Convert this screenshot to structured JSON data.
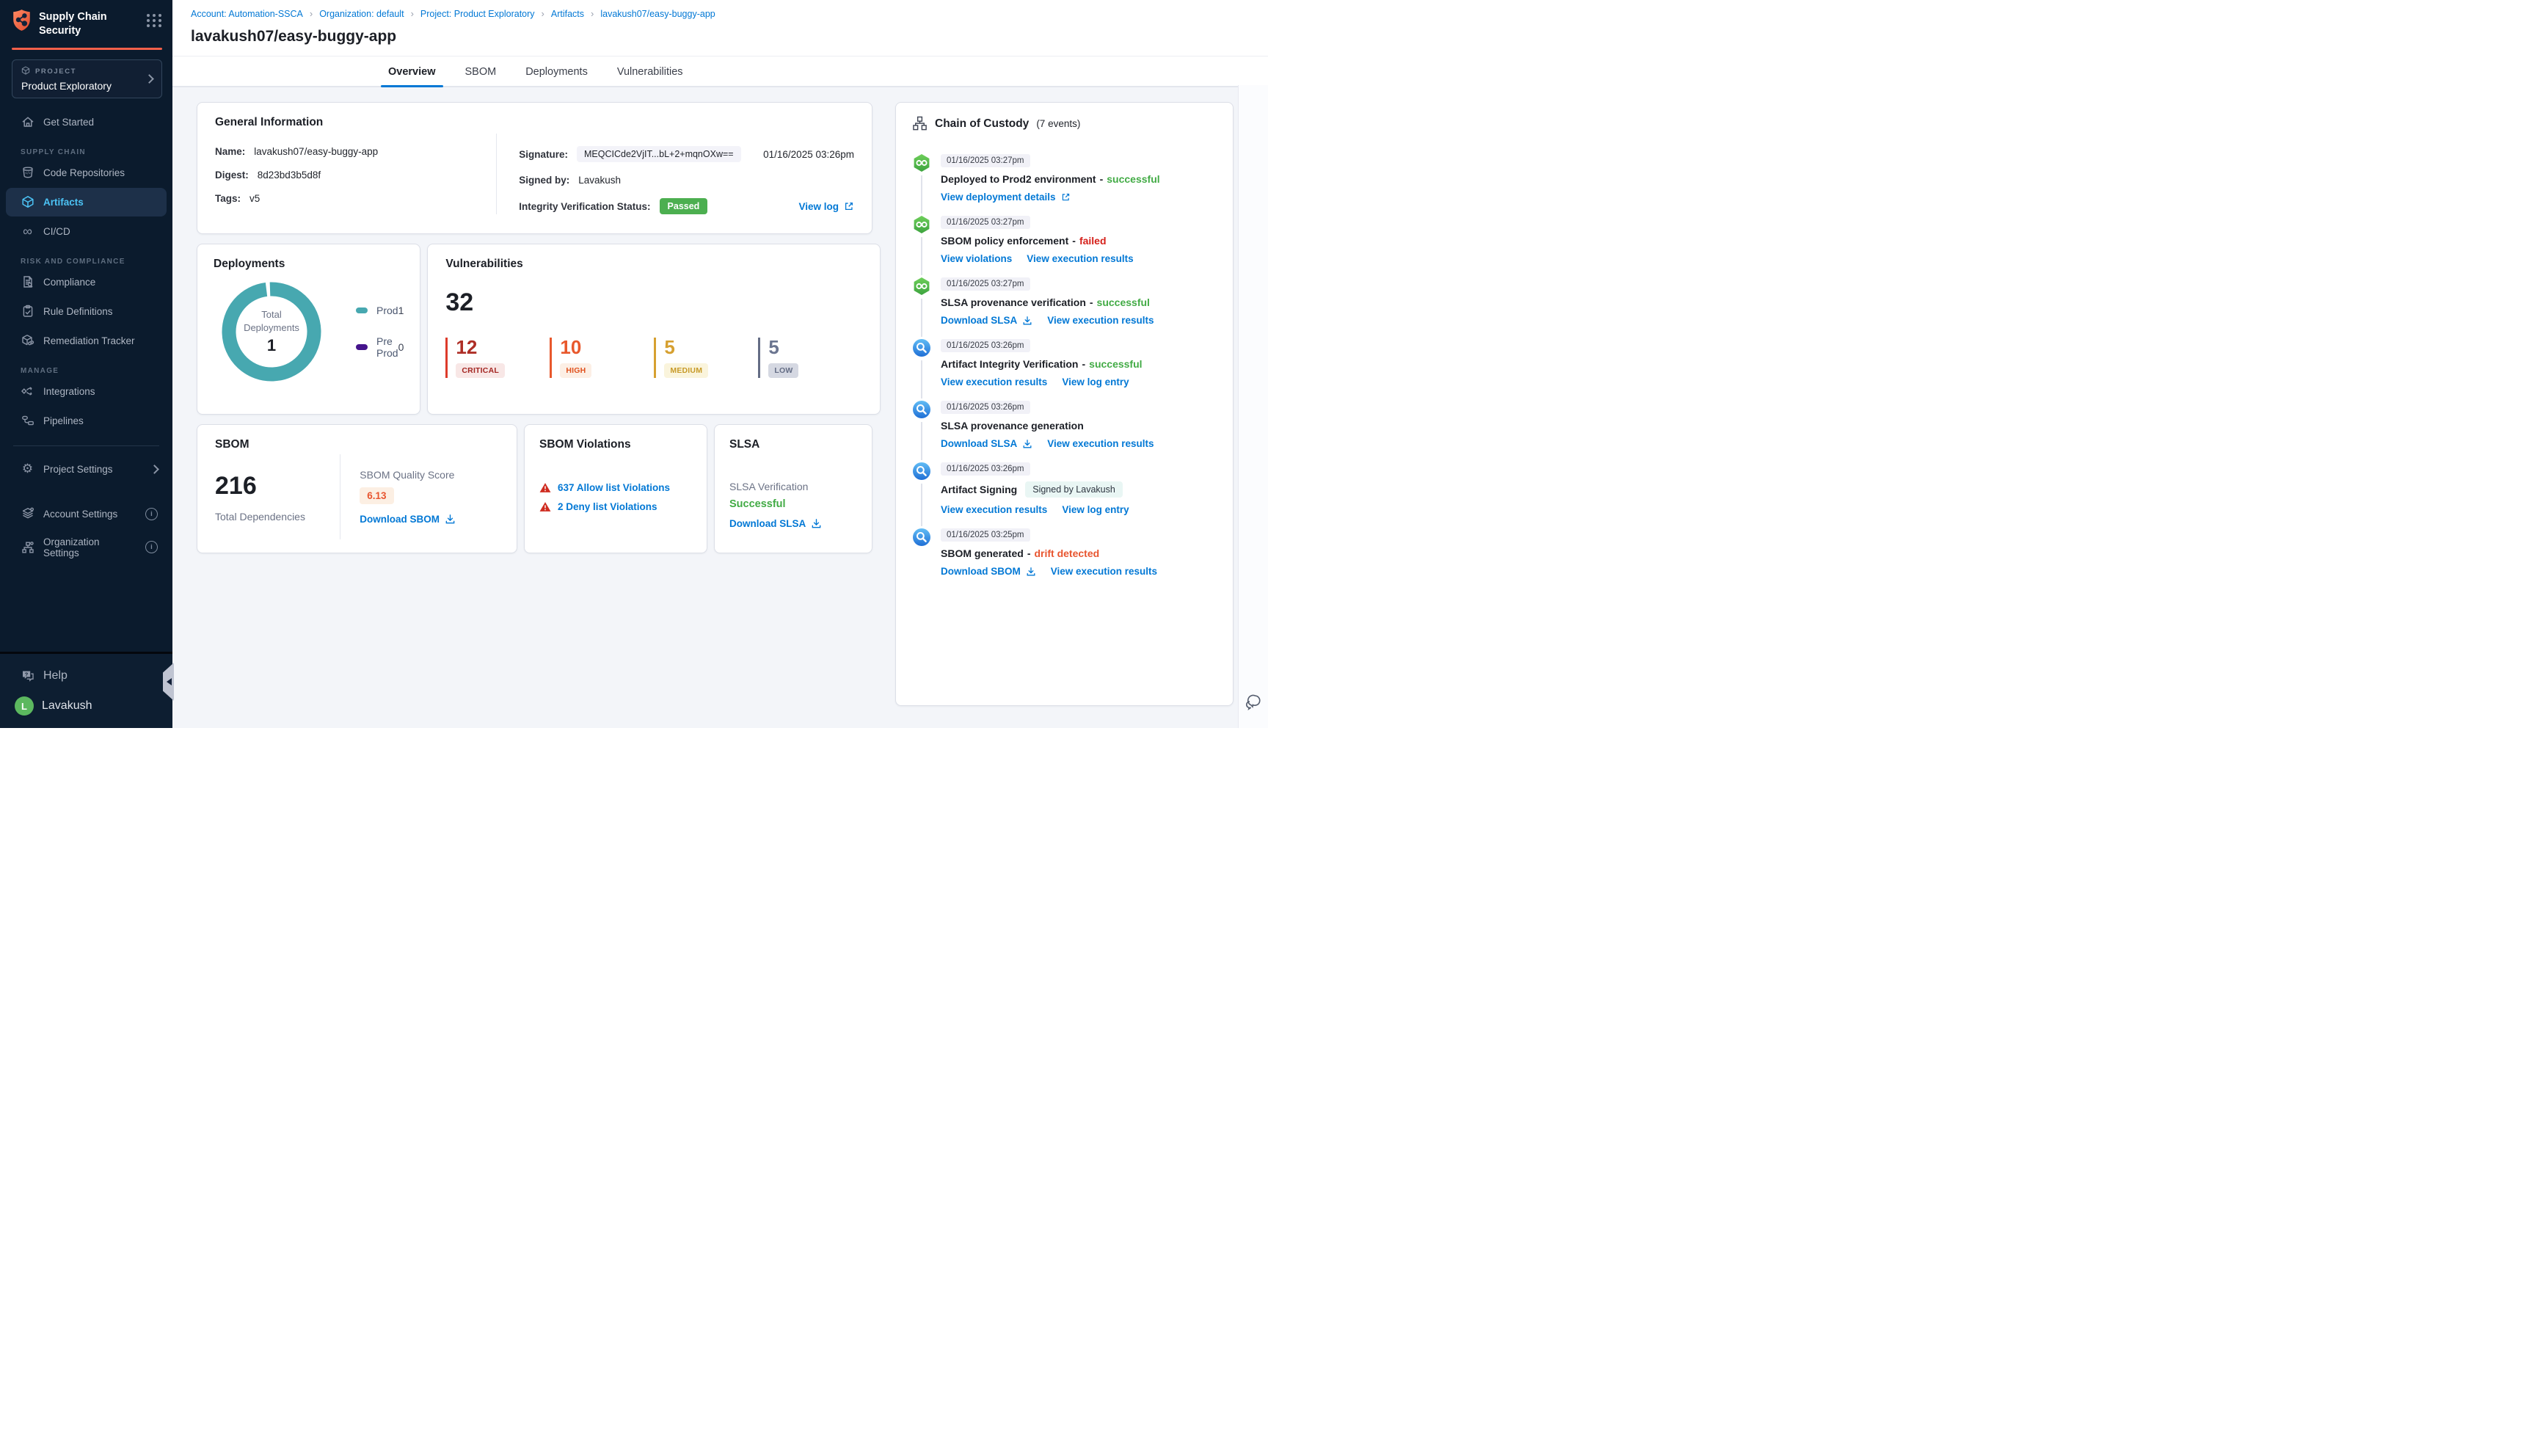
{
  "app": {
    "title": "Supply Chain Security"
  },
  "icons": {
    "cicd": "∞",
    "gear": "⚙",
    "breadcrumb_separator": "›",
    "info": "i"
  },
  "colors": {
    "accent_blue": "#0278d5",
    "brand_orange": "#f4604a",
    "sidebar_bg": "#0b1b2d",
    "success_green": "#42ab45",
    "failed_red": "#d5201a",
    "drift_orange": "#e8552f",
    "donut_teal": "#47a8b0",
    "preprod_purple": "#45148c",
    "passed_badge_green": "#4caf50"
  },
  "sidebar": {
    "project_label": "PROJECT",
    "project_name": "Product Exploratory",
    "get_started": "Get Started",
    "section_supply_chain": "SUPPLY CHAIN",
    "code_repositories": "Code Repositories",
    "artifacts": "Artifacts",
    "cicd": "CI/CD",
    "section_risk_compliance": "RISK AND COMPLIANCE",
    "compliance": "Compliance",
    "rule_definitions": "Rule Definitions",
    "remediation_tracker": "Remediation Tracker",
    "section_manage": "MANAGE",
    "integrations": "Integrations",
    "pipelines": "Pipelines",
    "project_settings": "Project Settings",
    "account_settings": "Account Settings",
    "organization_settings": "Organization Settings",
    "help": "Help",
    "user_name": "Lavakush",
    "user_initial": "L"
  },
  "breadcrumb": {
    "items": [
      "Account: Automation-SSCA",
      "Organization: default",
      "Project: Product Exploratory",
      "Artifacts",
      "lavakush07/easy-buggy-app"
    ]
  },
  "header": {
    "title": "lavakush07/easy-buggy-app"
  },
  "tabs": {
    "items": [
      "Overview",
      "SBOM",
      "Deployments",
      "Vulnerabilities"
    ],
    "active": "Overview"
  },
  "general_info": {
    "title": "General Information",
    "name_label": "Name:",
    "name": "lavakush07/easy-buggy-app",
    "digest_label": "Digest:",
    "digest": "8d23bd3b5d8f",
    "tags_label": "Tags:",
    "tags": "v5",
    "signature_label": "Signature:",
    "signature": "MEQCICde2VjIT...bL+2+mqnOXw==",
    "signature_date": "01/16/2025 03:26pm",
    "signed_by_label": "Signed by:",
    "signed_by": "Lavakush",
    "integrity_label": "Integrity Verification Status:",
    "integrity_status": "Passed",
    "view_log": "View log"
  },
  "deployments": {
    "title": "Deployments",
    "center_label_line1": "Total",
    "center_label_line2": "Deployments",
    "total": "1",
    "legend": [
      {
        "label": "Prod",
        "value": "1"
      },
      {
        "label": "Pre Prod",
        "value": "0"
      }
    ],
    "chart": {
      "type": "pie",
      "categories": [
        "Prod",
        "Pre Prod"
      ],
      "values": [
        1,
        0
      ],
      "total": 1
    }
  },
  "vulnerabilities": {
    "title": "Vulnerabilities",
    "total": "32",
    "severities": [
      {
        "count": "12",
        "label": "CRITICAL"
      },
      {
        "count": "10",
        "label": "HIGH"
      },
      {
        "count": "5",
        "label": "MEDIUM"
      },
      {
        "count": "5",
        "label": "LOW"
      }
    ]
  },
  "sbom": {
    "title": "SBOM",
    "total": "216",
    "total_label": "Total Dependencies",
    "quality_label": "SBOM Quality Score",
    "quality_score": "6.13",
    "download_label": "Download SBOM"
  },
  "sbom_violations": {
    "title": "SBOM Violations",
    "links": [
      "637 Allow list Violations",
      "2 Deny list Violations"
    ]
  },
  "slsa": {
    "title": "SLSA",
    "verification_label": "SLSA Verification",
    "status": "Successful",
    "download_label": "Download SLSA"
  },
  "chain_of_custody": {
    "title": "Chain of Custody",
    "count_label": "(7 events)",
    "events": [
      {
        "time": "01/16/2025 03:27pm",
        "title": "Deployed to Prod2 environment",
        "separator": "-",
        "status": "successful",
        "links": [
          "View deployment details"
        ]
      },
      {
        "time": "01/16/2025 03:27pm",
        "title": "SBOM policy enforcement",
        "separator": "-",
        "status": "failed",
        "links": [
          "View violations",
          "View execution results"
        ]
      },
      {
        "time": "01/16/2025 03:27pm",
        "title": "SLSA provenance verification",
        "separator": "-",
        "status": "successful",
        "links": [
          "Download SLSA",
          "View execution results"
        ]
      },
      {
        "time": "01/16/2025 03:26pm",
        "title": "Artifact Integrity Verification",
        "separator": "-",
        "status": "successful",
        "links": [
          "View execution results",
          "View log entry"
        ]
      },
      {
        "time": "01/16/2025 03:26pm",
        "title": "SLSA provenance generation",
        "links": [
          "Download SLSA",
          "View execution results"
        ]
      },
      {
        "time": "01/16/2025 03:26pm",
        "title": "Artifact Signing",
        "badge": "Signed by Lavakush",
        "links": [
          "View execution results",
          "View log entry"
        ]
      },
      {
        "time": "01/16/2025 03:25pm",
        "title": "SBOM generated",
        "separator": "-",
        "status": "drift detected",
        "links": [
          "Download SBOM",
          "View execution results"
        ]
      }
    ]
  }
}
